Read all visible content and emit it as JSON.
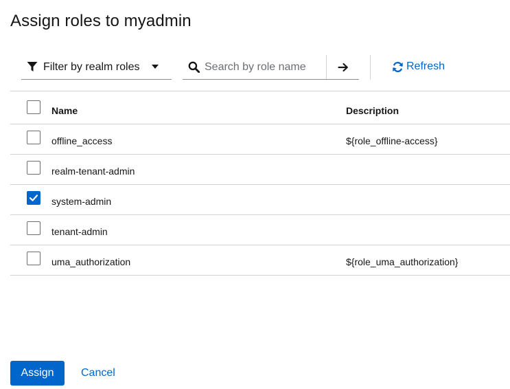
{
  "modal": {
    "title": "Assign roles to myadmin"
  },
  "toolbar": {
    "filter_label": "Filter by realm roles",
    "search_placeholder": "Search by role name",
    "search_value": "",
    "refresh_label": "Refresh"
  },
  "table": {
    "columns": {
      "name": "Name",
      "description": "Description"
    },
    "select_all_checked": false,
    "rows": [
      {
        "name": "offline_access",
        "description": "${role_offline-access}",
        "checked": false
      },
      {
        "name": "realm-tenant-admin",
        "description": "",
        "checked": false
      },
      {
        "name": "system-admin",
        "description": "",
        "checked": true
      },
      {
        "name": "tenant-admin",
        "description": "",
        "checked": false
      },
      {
        "name": "uma_authorization",
        "description": "${role_uma_authorization}",
        "checked": false
      }
    ]
  },
  "footer": {
    "assign_label": "Assign",
    "cancel_label": "Cancel"
  },
  "colors": {
    "primary": "#0066cc",
    "border": "#d2d2d2"
  }
}
